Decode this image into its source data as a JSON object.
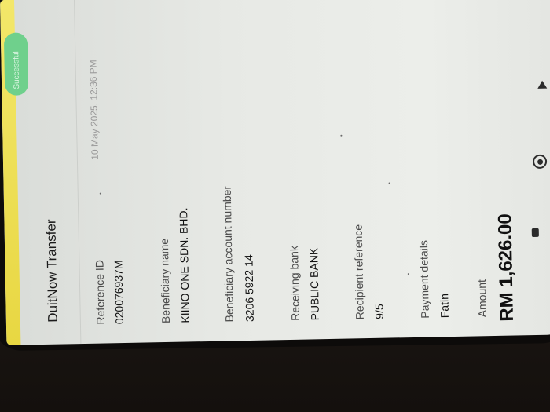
{
  "screen": {
    "title": "DuitNow Transfer",
    "status_badge": "Successful",
    "date_time": "10 May 2025, 12:36 PM"
  },
  "fields": [
    {
      "label": "Reference ID",
      "value": "020076937M"
    },
    {
      "label": "Beneficiary name",
      "value": "KIINO ONE SDN. BHD."
    },
    {
      "label": "Beneficiary account number",
      "value": "3206 5922 14"
    },
    {
      "label": "Receiving bank",
      "value": "PUBLIC BANK"
    },
    {
      "label": "Recipient reference",
      "value": "9/5"
    },
    {
      "label": "Payment details",
      "value": "Fatin"
    },
    {
      "label": "Amount",
      "value": "RM 1,626.00"
    }
  ],
  "nav": {
    "icons": [
      "recent-apps-icon",
      "home-icon",
      "back-icon"
    ]
  },
  "colors": {
    "accent_yellow": "#ecdc4e",
    "success_green": "#6fd08c",
    "screen_bg": "#e7e9e5"
  }
}
